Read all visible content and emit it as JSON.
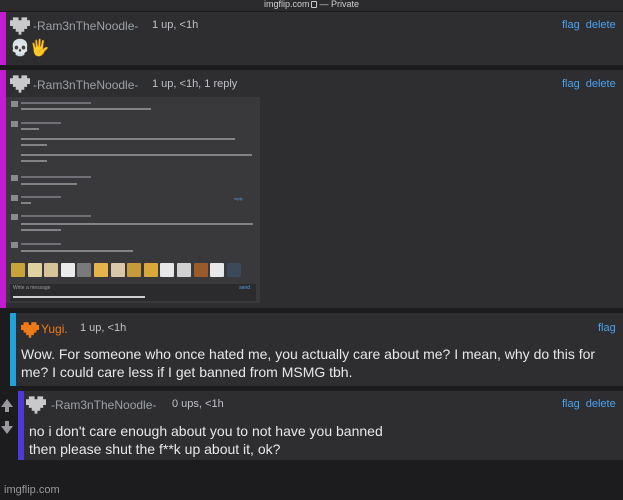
{
  "browser": {
    "url": "imgflip.com",
    "privacy": "Private"
  },
  "actions": {
    "flag": "flag",
    "delete": "delete"
  },
  "comments": [
    {
      "user": "-Ram3nTheNoodle-",
      "meta": "1 up, <1h",
      "text": "💀🖐",
      "bar_color": "#c21bd1"
    },
    {
      "user": "-Ram3nTheNoodle-",
      "meta": "1 up, <1h, 1 reply",
      "text": "",
      "bar_color": "#c21bd1"
    },
    {
      "user": "Yugi",
      "user_dot": ".",
      "meta": "1 up, <1h",
      "text_lines": [
        "Wow. For someone who once hated me, you actually care about me? I mean, why do this for",
        "me? I could care less if I get banned from MSMG tbh."
      ],
      "bar_color": "#1ea3d8",
      "name_color": "#f07a18"
    },
    {
      "user": "-Ram3nTheNoodle-",
      "meta": "0 ups, <1h",
      "text_lines": [
        "no i don't care enough about you to not have you banned",
        "then please shut the f**k up about it, ok?"
      ],
      "bar_color": "#4c3bd6"
    }
  ],
  "embed": {
    "reply_label": "reply",
    "write_placeholder": "Write a message",
    "send_label": "send"
  },
  "footer": {
    "watermark": "imgflip.com"
  }
}
